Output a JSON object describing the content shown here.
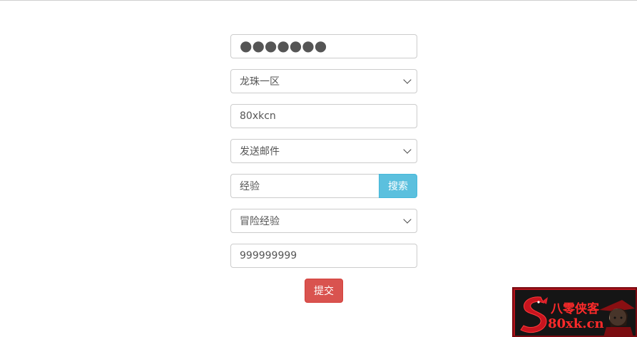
{
  "form": {
    "password_value": "●●●●●●●",
    "server_select_value": "龙珠一区",
    "username_value": "80xkcn",
    "action_select_value": "发送邮件",
    "search_input_value": "经验",
    "search_button_label": "搜索",
    "item_select_value": "冒险经验",
    "quantity_value": "999999999",
    "submit_button_label": "提交"
  },
  "watermark": {
    "title": "八零侠客",
    "domain": "80xk.cn"
  },
  "colors": {
    "info_button": "#5bc0de",
    "danger_button": "#d9534f",
    "watermark_red": "#b3131c"
  },
  "icons": {
    "select_arrow": "chevron-down-icon",
    "logo": "dragon-logo-icon"
  }
}
